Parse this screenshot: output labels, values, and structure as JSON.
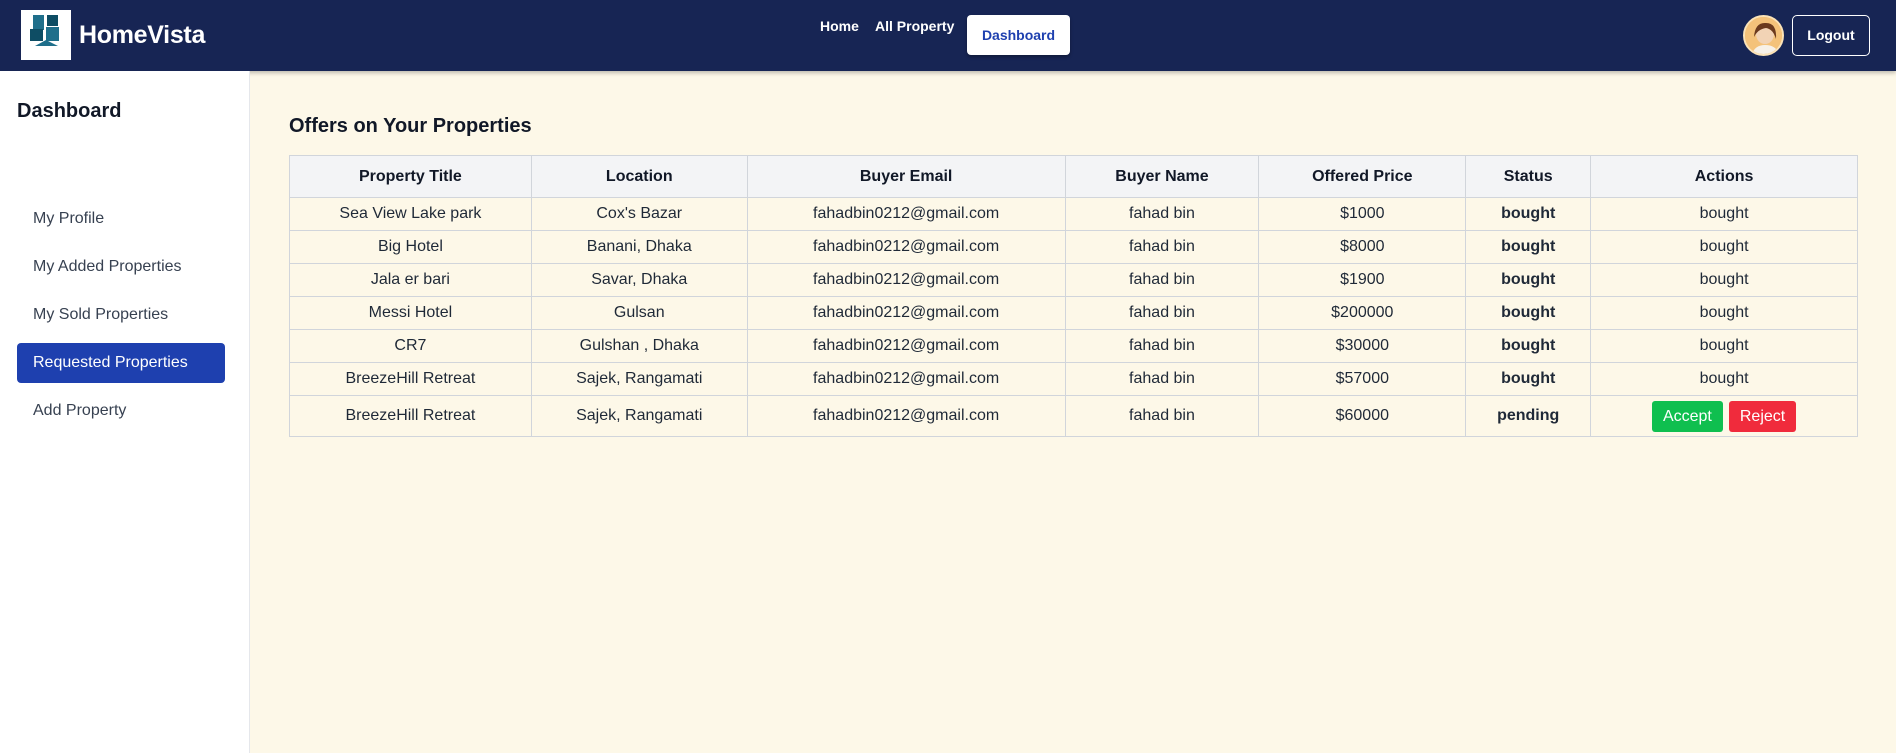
{
  "navbar": {
    "brand": "HomeVista",
    "logo_text": "HOMEVISTA",
    "links": [
      "Home",
      "All Property"
    ],
    "active_link": "Dashboard",
    "logout_label": "Logout"
  },
  "sidebar": {
    "title": "Dashboard",
    "items": [
      {
        "label": "My Profile",
        "active": false
      },
      {
        "label": "My Added Properties",
        "active": false
      },
      {
        "label": "My Sold Properties",
        "active": false
      },
      {
        "label": "Requested Properties",
        "active": true
      },
      {
        "label": "Add Property",
        "active": false
      }
    ]
  },
  "main": {
    "title": "Offers on Your Properties",
    "columns": [
      "Property Title",
      "Location",
      "Buyer Email",
      "Buyer Name",
      "Offered Price",
      "Status",
      "Actions"
    ],
    "rows": [
      {
        "title": "Sea View Lake park",
        "location": "Cox's Bazar",
        "email": "fahadbin0212@gmail.com",
        "buyer": "fahad bin",
        "price": "$1000",
        "status": "bought",
        "action": "bought"
      },
      {
        "title": "Big Hotel",
        "location": "Banani, Dhaka",
        "email": "fahadbin0212@gmail.com",
        "buyer": "fahad bin",
        "price": "$8000",
        "status": "bought",
        "action": "bought"
      },
      {
        "title": "Jala er bari",
        "location": "Savar, Dhaka",
        "email": "fahadbin0212@gmail.com",
        "buyer": "fahad bin",
        "price": "$1900",
        "status": "bought",
        "action": "bought"
      },
      {
        "title": "Messi Hotel",
        "location": "Gulsan",
        "email": "fahadbin0212@gmail.com",
        "buyer": "fahad bin",
        "price": "$200000",
        "status": "bought",
        "action": "bought"
      },
      {
        "title": "CR7",
        "location": "Gulshan , Dhaka",
        "email": "fahadbin0212@gmail.com",
        "buyer": "fahad bin",
        "price": "$30000",
        "status": "bought",
        "action": "bought"
      },
      {
        "title": "BreezeHill Retreat",
        "location": "Sajek, Rangamati",
        "email": "fahadbin0212@gmail.com",
        "buyer": "fahad bin",
        "price": "$57000",
        "status": "bought",
        "action": "bought"
      },
      {
        "title": "BreezeHill Retreat",
        "location": "Sajek, Rangamati",
        "email": "fahadbin0212@gmail.com",
        "buyer": "fahad bin",
        "price": "$60000",
        "status": "pending",
        "action": "buttons"
      }
    ],
    "accept_label": "Accept",
    "reject_label": "Reject"
  },
  "colors": {
    "navbar_bg": "#172554",
    "active_blue": "#1e40af",
    "page_bg": "#fdf8e8",
    "accept_green": "#0fbf4f",
    "reject_red": "#f02b3c"
  }
}
